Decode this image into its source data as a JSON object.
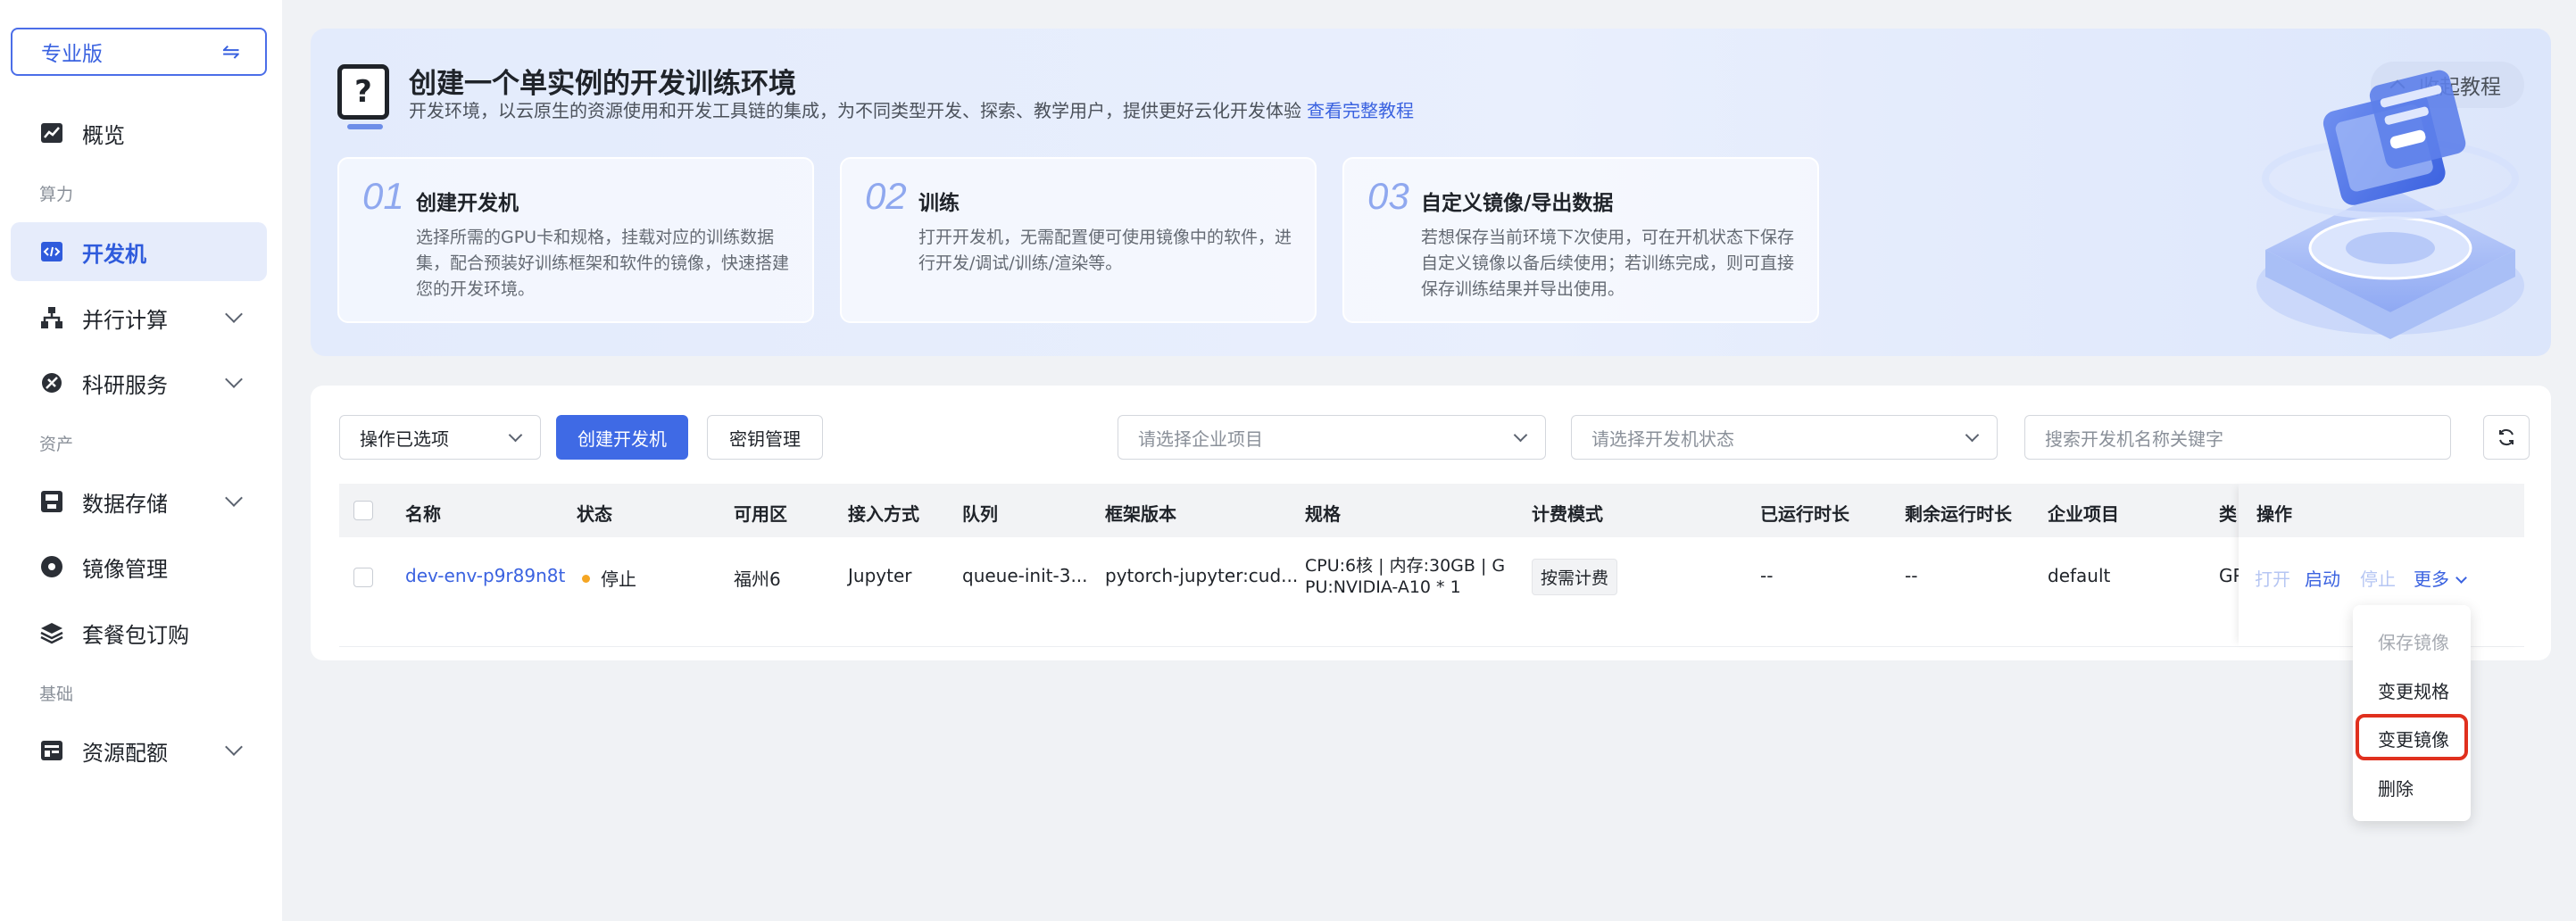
{
  "sidebar": {
    "edition": "专业版",
    "items": [
      {
        "label": "概览"
      },
      {
        "group": "算力"
      },
      {
        "label": "开发机"
      },
      {
        "label": "并行计算"
      },
      {
        "label": "科研服务"
      },
      {
        "group": "资产"
      },
      {
        "label": "数据存储"
      },
      {
        "label": "镜像管理"
      },
      {
        "label": "套餐包订购"
      },
      {
        "group": "基础"
      },
      {
        "label": "资源配额"
      }
    ]
  },
  "banner": {
    "title": "创建一个单实例的开发训练环境",
    "subtitle": "开发环境，以云原生的资源使用和开发工具链的集成，为不同类型开发、探索、教学用户，提供更好云化开发体验",
    "tutorial_link": "查看完整教程",
    "collapse_label": "收起教程",
    "steps": [
      {
        "num": "01",
        "title": "创建开发机",
        "desc": "选择所需的GPU卡和规格，挂载对应的训练数据集，配合预装好训练框架和软件的镜像，快速搭建您的开发环境。"
      },
      {
        "num": "02",
        "title": "训练",
        "desc": "打开开发机，无需配置便可使用镜像中的软件，进行开发/调试/训练/渲染等。"
      },
      {
        "num": "03",
        "title": "自定义镜像/导出数据",
        "desc": "若想保存当前环境下次使用，可在开机状态下保存自定义镜像以备后续使用；若训练完成，则可直接保存训练结果并导出使用。"
      }
    ]
  },
  "toolbar": {
    "batch_select": "操作已选项",
    "create_button": "创建开发机",
    "key_button": "密钥管理",
    "project_placeholder": "请选择企业项目",
    "status_placeholder": "请选择开发机状态",
    "search_placeholder": "搜索开发机名称关键字"
  },
  "table": {
    "columns": [
      "名称",
      "状态",
      "可用区",
      "接入方式",
      "队列",
      "框架版本",
      "规格",
      "计费模式",
      "已运行时长",
      "剩余运行时长",
      "企业项目",
      "类型",
      "操作"
    ],
    "rows": [
      {
        "name": "dev-env-p9r89n8t",
        "status": "停止",
        "zone": "福州6",
        "access": "Jupyter",
        "queue": "queue-init-3...",
        "framework": "pytorch-jupyter:cud...",
        "spec_line1": "CPU:6核 | 内存:30GB | G",
        "spec_line2": "PU:NVIDIA-A10 * 1",
        "billing": "按需计费",
        "run_time": "--",
        "remain_time": "--",
        "project": "default",
        "type": "GPU",
        "actions": {
          "open": "打开",
          "start": "启动",
          "stop": "停止",
          "more": "更多"
        }
      }
    ]
  },
  "more_menu": {
    "items": [
      "保存镜像",
      "变更规格",
      "变更镜像",
      "删除"
    ],
    "disabled": [
      "保存镜像"
    ],
    "highlighted": "变更镜像"
  }
}
